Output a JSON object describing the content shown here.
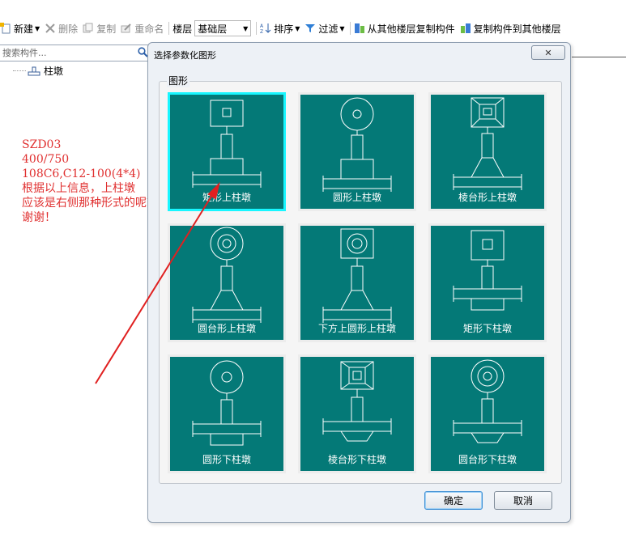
{
  "toolbar": {
    "new_label": "新建",
    "delete_label": "删除",
    "copy_label": "复制",
    "rename_label": "重命名",
    "floor_label": "楼层",
    "floor_value": "基础层",
    "sort_label": "排序",
    "filter_label": "过滤",
    "copy_from_floor_label": "从其他楼层复制构件",
    "copy_to_floor_label": "复制构件到其他楼层"
  },
  "left_panel": {
    "search_placeholder": "搜索构件...",
    "tree_item": "柱墩"
  },
  "annotation": {
    "lines": [
      "SZD03",
      "400/750",
      "108C6,C12-100(4*4)",
      "根据以上信息，上柱墩",
      "应该是右侧那种形式的呢？",
      "谢谢！"
    ],
    "color": "#e03030"
  },
  "dialog": {
    "title": "选择参数化图形",
    "close_icon": "x-icon",
    "group_label": "图形",
    "shapes": [
      {
        "label": "矩形上柱墩",
        "selected": true
      },
      {
        "label": "圆形上柱墩",
        "selected": false
      },
      {
        "label": "棱台形上柱墩",
        "selected": false
      },
      {
        "label": "圆台形上柱墩",
        "selected": false
      },
      {
        "label": "下方上圆形上柱墩",
        "selected": false
      },
      {
        "label": "矩形下柱墩",
        "selected": false
      },
      {
        "label": "圆形下柱墩",
        "selected": false
      },
      {
        "label": "棱台形下柱墩",
        "selected": false
      },
      {
        "label": "圆台形下柱墩",
        "selected": false
      }
    ],
    "ok_label": "确定",
    "cancel_label": "取消",
    "tile_color": "#047977",
    "selected_border_color": "#18f6ff"
  }
}
